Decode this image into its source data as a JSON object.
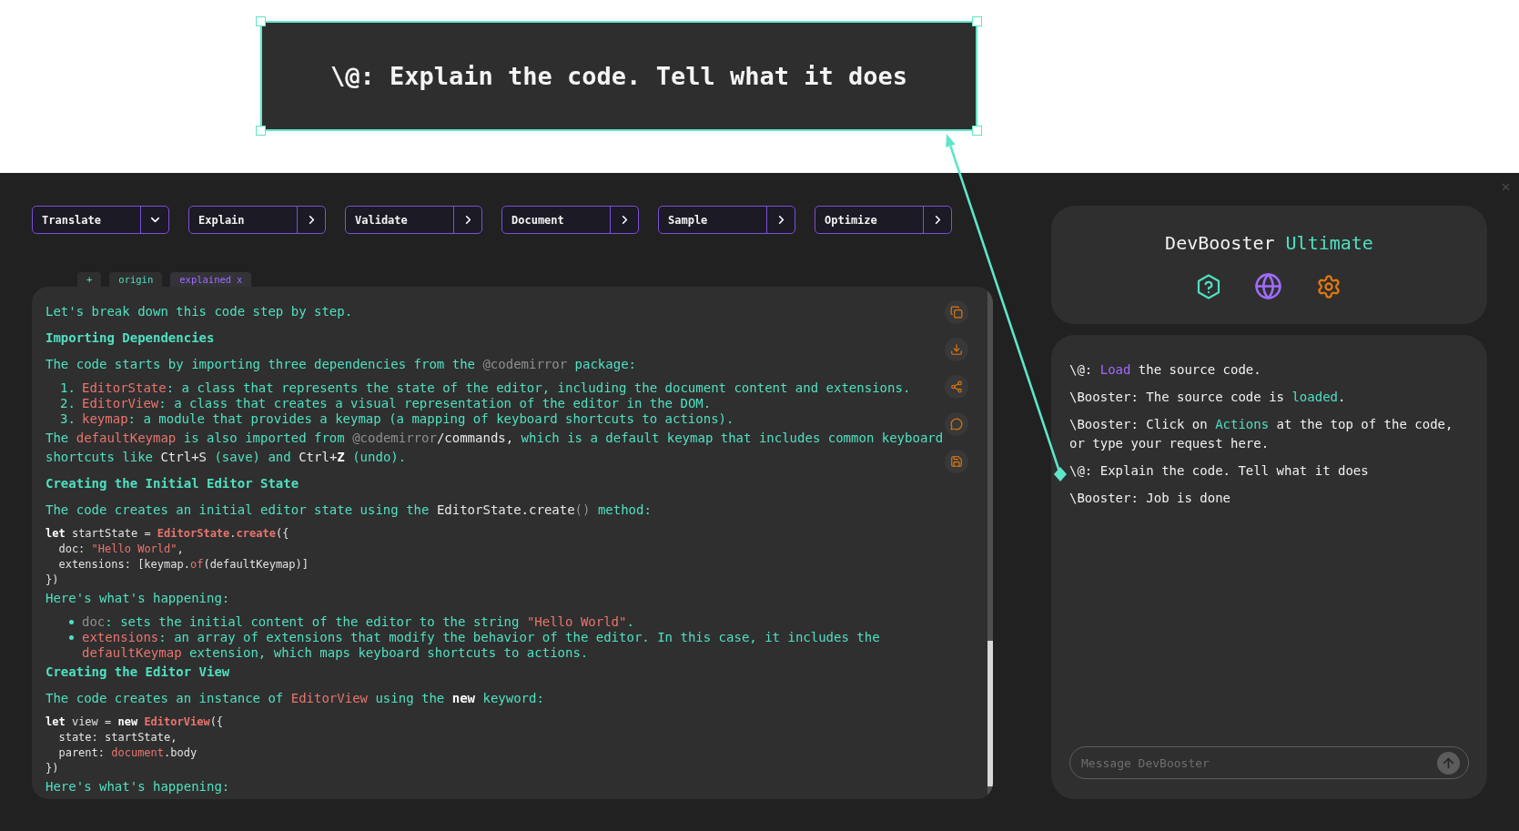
{
  "callout": {
    "text": "\\@: Explain the code. Tell what it does"
  },
  "toolbar": {
    "buttons": [
      {
        "label": "Translate",
        "kind": "dropdown"
      },
      {
        "label": "Explain",
        "kind": "run"
      },
      {
        "label": "Validate",
        "kind": "run"
      },
      {
        "label": "Document",
        "kind": "run"
      },
      {
        "label": "Sample",
        "kind": "run"
      },
      {
        "label": "Optimize",
        "kind": "run"
      }
    ]
  },
  "tabs": [
    {
      "label": "+",
      "selected": false
    },
    {
      "label": "origin",
      "selected": false
    },
    {
      "label": "explained",
      "selected": true,
      "close": "x"
    }
  ],
  "content": {
    "blocks": [
      {
        "kind": "paragraph",
        "segments": [
          {
            "text": "Let's break down this code step by step.",
            "kind": "text"
          }
        ]
      },
      {
        "kind": "heading",
        "text": "Importing Dependencies"
      },
      {
        "kind": "paragraph",
        "segments": [
          {
            "text": "The code starts by importing three dependencies from the ",
            "kind": "text"
          },
          {
            "text": "@codemirror",
            "kind": "muted"
          },
          {
            "text": " package:",
            "kind": "text"
          }
        ]
      },
      {
        "kind": "ordered_list",
        "items": [
          {
            "number": "1.",
            "segments": [
              {
                "text": "EditorState",
                "kind": "ident"
              },
              {
                "text": ": a class that represents the state of the editor, including the document content and extensions.",
                "kind": "text"
              }
            ]
          },
          {
            "number": "2.",
            "segments": [
              {
                "text": "EditorView",
                "kind": "ident"
              },
              {
                "text": ": a class that creates a visual representation of the editor in the DOM.",
                "kind": "text"
              }
            ]
          },
          {
            "number": "3.",
            "segments": [
              {
                "text": "keymap",
                "kind": "ident"
              },
              {
                "text": ": a module that provides a keymap (a mapping of keyboard shortcuts to actions).",
                "kind": "text"
              }
            ]
          }
        ]
      },
      {
        "kind": "paragraph",
        "segments": [
          {
            "text": "The ",
            "kind": "text"
          },
          {
            "text": "defaultKeymap",
            "kind": "ident"
          },
          {
            "text": " is also imported from ",
            "kind": "text"
          },
          {
            "text": "@codemirror",
            "kind": "muted"
          },
          {
            "text": "/commands,",
            "kind": "code"
          },
          {
            "text": " which is a default keymap that includes common keyboard shortcuts like ",
            "kind": "text"
          },
          {
            "text": "Ctrl+S",
            "kind": "code"
          },
          {
            "text": " (save) and ",
            "kind": "text"
          },
          {
            "text": "Ctrl+",
            "kind": "code"
          },
          {
            "text": "Z",
            "kind": "strong"
          },
          {
            "text": " (undo).",
            "kind": "text"
          }
        ]
      },
      {
        "kind": "heading",
        "text": "Creating the Initial Editor State"
      },
      {
        "kind": "paragraph",
        "segments": [
          {
            "text": "The code creates an initial editor state using the ",
            "kind": "text"
          },
          {
            "text": "EditorState.create",
            "kind": "code"
          },
          {
            "text": "()",
            "kind": "muted"
          },
          {
            "text": " method:",
            "kind": "text"
          }
        ]
      },
      {
        "kind": "code",
        "lines": [
          {
            "segments": [
              {
                "text": "let",
                "kind": "keyword"
              },
              {
                "text": " startState = ",
                "kind": "plain"
              },
              {
                "text": "EditorState",
                "kind": "type"
              },
              {
                "text": ".",
                "kind": "plain"
              },
              {
                "text": "create",
                "kind": "type"
              },
              {
                "text": "({",
                "kind": "plain"
              }
            ]
          },
          {
            "segments": [
              {
                "text": "  doc: ",
                "kind": "plain"
              },
              {
                "text": "\"Hello World\"",
                "kind": "string"
              },
              {
                "text": ",",
                "kind": "plain"
              }
            ]
          },
          {
            "segments": [
              {
                "text": "  extensions: [keymap.",
                "kind": "plain"
              },
              {
                "text": "of",
                "kind": "call"
              },
              {
                "text": "(defaultKeymap)]",
                "kind": "plain"
              }
            ]
          },
          {
            "segments": [
              {
                "text": "})",
                "kind": "plain"
              }
            ]
          }
        ]
      },
      {
        "kind": "paragraph",
        "segments": [
          {
            "text": "Here's what's happening:",
            "kind": "text"
          }
        ]
      },
      {
        "kind": "bullet_list",
        "items": [
          {
            "segments": [
              {
                "text": "doc",
                "kind": "muted"
              },
              {
                "text": ": sets the initial content of the editor to the string ",
                "kind": "text"
              },
              {
                "text": "\"Hello World\"",
                "kind": "ident"
              },
              {
                "text": ".",
                "kind": "text"
              }
            ]
          },
          {
            "segments": [
              {
                "text": "extensions",
                "kind": "ident"
              },
              {
                "text": ": an array of extensions that modify the behavior of the editor. In this case, it includes the ",
                "kind": "text"
              },
              {
                "text": "defaultKeymap",
                "kind": "ident"
              },
              {
                "text": " extension, which maps keyboard shortcuts to actions.",
                "kind": "text"
              }
            ]
          }
        ]
      },
      {
        "kind": "heading",
        "text": "Creating the Editor View"
      },
      {
        "kind": "paragraph",
        "segments": [
          {
            "text": "The code creates an instance of ",
            "kind": "text"
          },
          {
            "text": "EditorView",
            "kind": "ident"
          },
          {
            "text": " using the ",
            "kind": "text"
          },
          {
            "text": "new",
            "kind": "strong"
          },
          {
            "text": " keyword:",
            "kind": "text"
          }
        ]
      },
      {
        "kind": "code",
        "lines": [
          {
            "segments": [
              {
                "text": "let",
                "kind": "keyword"
              },
              {
                "text": " view = ",
                "kind": "plain"
              },
              {
                "text": "new ",
                "kind": "keyword"
              },
              {
                "text": "EditorView",
                "kind": "type"
              },
              {
                "text": "({",
                "kind": "plain"
              }
            ]
          },
          {
            "segments": [
              {
                "text": "  state: startState,",
                "kind": "plain"
              }
            ]
          },
          {
            "segments": [
              {
                "text": "  parent: ",
                "kind": "plain"
              },
              {
                "text": "document",
                "kind": "call"
              },
              {
                "text": ".body",
                "kind": "plain"
              }
            ]
          },
          {
            "segments": [
              {
                "text": "})",
                "kind": "plain"
              }
            ]
          }
        ]
      },
      {
        "kind": "paragraph",
        "segments": [
          {
            "text": "Here's what's happening:",
            "kind": "text"
          }
        ]
      }
    ]
  },
  "assistant": {
    "title": {
      "name": "DevBooster",
      "edition": "Ultimate"
    },
    "messages": [
      {
        "segments": [
          {
            "text": "\\@: ",
            "kind": "plain"
          },
          {
            "text": "Load",
            "kind": "verb"
          },
          {
            "text": " the source code.",
            "kind": "plain"
          }
        ]
      },
      {
        "segments": [
          {
            "text": "\\Booster: The source code is ",
            "kind": "plain"
          },
          {
            "text": "loaded",
            "kind": "highlight"
          },
          {
            "text": ".",
            "kind": "plain"
          }
        ]
      },
      {
        "segments": [
          {
            "text": "\\Booster: Click on ",
            "kind": "plain"
          },
          {
            "text": "Actions",
            "kind": "highlight"
          },
          {
            "text": " at the top of the code, or type your request here.",
            "kind": "plain"
          }
        ]
      },
      {
        "segments": [
          {
            "text": "\\@: Explain the code. Tell what it does",
            "kind": "plain"
          }
        ]
      },
      {
        "segments": [
          {
            "text": "\\Booster: Job is done",
            "kind": "plain"
          }
        ]
      }
    ],
    "input": {
      "placeholder": "Message DevBooster"
    }
  }
}
